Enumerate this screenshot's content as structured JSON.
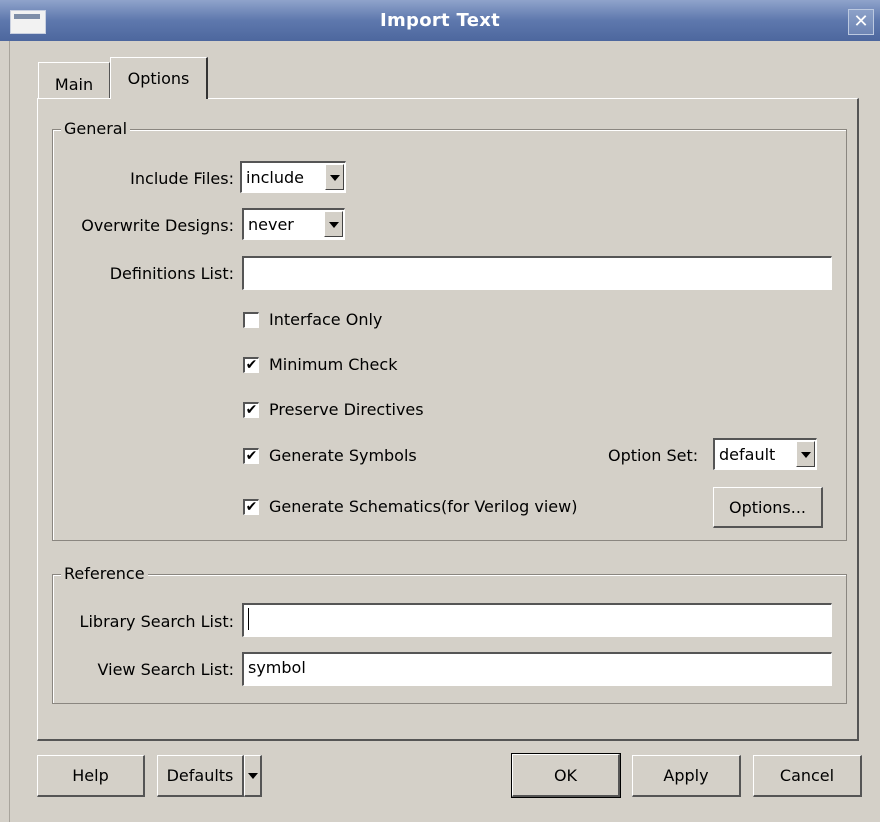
{
  "window": {
    "title": "Import Text"
  },
  "tabs": [
    {
      "label": "Main"
    },
    {
      "label": "Options"
    }
  ],
  "general": {
    "title": "General",
    "include_files": {
      "label": "Include Files:",
      "value": "include"
    },
    "overwrite_designs": {
      "label": "Overwrite Designs:",
      "value": "never"
    },
    "definitions_list": {
      "label": "Definitions List:",
      "value": ""
    },
    "checks": [
      {
        "label": "Interface Only",
        "checked": false
      },
      {
        "label": "Minimum Check",
        "checked": true
      },
      {
        "label": "Preserve Directives",
        "checked": true
      },
      {
        "label": "Generate Symbols",
        "checked": true
      },
      {
        "label": "Generate Schematics(for Verilog view)",
        "checked": true
      }
    ],
    "option_set": {
      "label": "Option Set:",
      "value": "default"
    },
    "options_button": "Options..."
  },
  "reference": {
    "title": "Reference",
    "library_search_list": {
      "label": "Library Search List:",
      "value": ""
    },
    "view_search_list": {
      "label": "View Search List:",
      "value": "symbol"
    }
  },
  "buttons": {
    "help": "Help",
    "defaults": "Defaults",
    "ok": "OK",
    "apply": "Apply",
    "cancel": "Cancel"
  }
}
